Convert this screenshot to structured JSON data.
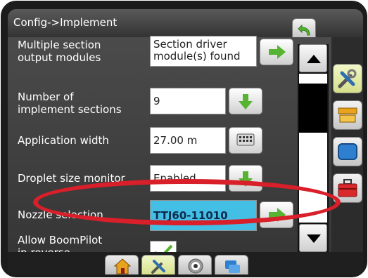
{
  "header": {
    "title": "Config->Implement"
  },
  "rows": [
    {
      "label": "Multiple section\noutput modules",
      "value": "Section driver\nmodule(s) found",
      "action": "arrow-right-icon"
    },
    {
      "label": "Number of\nimplement sections",
      "value": "9",
      "action": "arrow-down-icon"
    },
    {
      "label": "Application width",
      "value": "27.00 m",
      "action": "keyboard-icon"
    },
    {
      "label": "Droplet size monitor",
      "value": "Enabled",
      "action": "arrow-down-icon"
    },
    {
      "label": "Nozzle selection",
      "value": "TTJ60-11010",
      "action": "arrow-right-icon"
    },
    {
      "label": "Allow BoomPilot\nin reverse",
      "value": "",
      "checked": true
    }
  ],
  "side_tabs": [
    "tools-icon",
    "implement-icon",
    "screen-icon",
    "toolbox-icon"
  ],
  "bottom_tabs": [
    "home-icon",
    "tools-icon",
    "target-icon",
    "layers-icon"
  ],
  "colors": {
    "accent_green": "#57b332",
    "selected_field": "#43bfe6",
    "annotation": "#d81f2a"
  }
}
